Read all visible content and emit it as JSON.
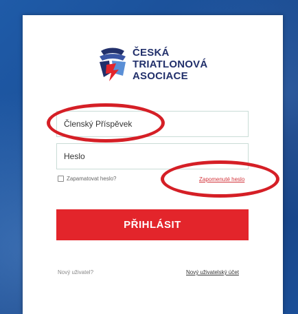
{
  "brand": {
    "line1": "ČESKÁ",
    "line2": "TRIATLONOVÁ",
    "line3": "ASOCIACE",
    "logo_icon": "cta-triathlon-logo-icon"
  },
  "form": {
    "member_placeholder": "Členský Příspěvek",
    "password_placeholder": "Heslo",
    "remember_label": "Zapamatovat heslo?",
    "forgot_label": "Zapomenuté heslo",
    "login_label": "PŘIHLÁSIT"
  },
  "footer": {
    "new_user_label": "Nový uživatel?",
    "new_account_label": "Nový uživatelský účet"
  },
  "colors": {
    "brand_text": "#22306b",
    "accent_red": "#e3252b",
    "annotation_red": "#d51f26",
    "background_blue": "#1a4e96"
  }
}
